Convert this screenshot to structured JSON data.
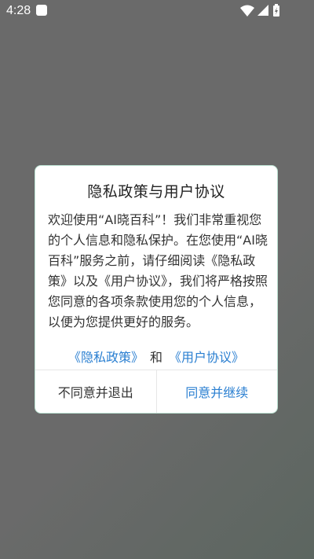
{
  "status_bar": {
    "time": "4:28"
  },
  "dialog": {
    "title": "隐私政策与用户协议",
    "body": "欢迎使用“AI晓百科”！我们非常重视您的个人信息和隐私保护。在您使用“AI晓百科”服务之前，请仔细阅读《隐私政策》以及《用户协议》，我们将严格按照您同意的各项条款使用您的个人信息，以便为您提供更好的服务。",
    "privacy_link": "《隐私政策》",
    "and_text": "和",
    "agreement_link": "《用户协议》",
    "decline_label": "不同意并退出",
    "accept_label": "同意并继续"
  },
  "colors": {
    "link": "#2a7fd1",
    "dialog_border": "#bde3d3"
  }
}
